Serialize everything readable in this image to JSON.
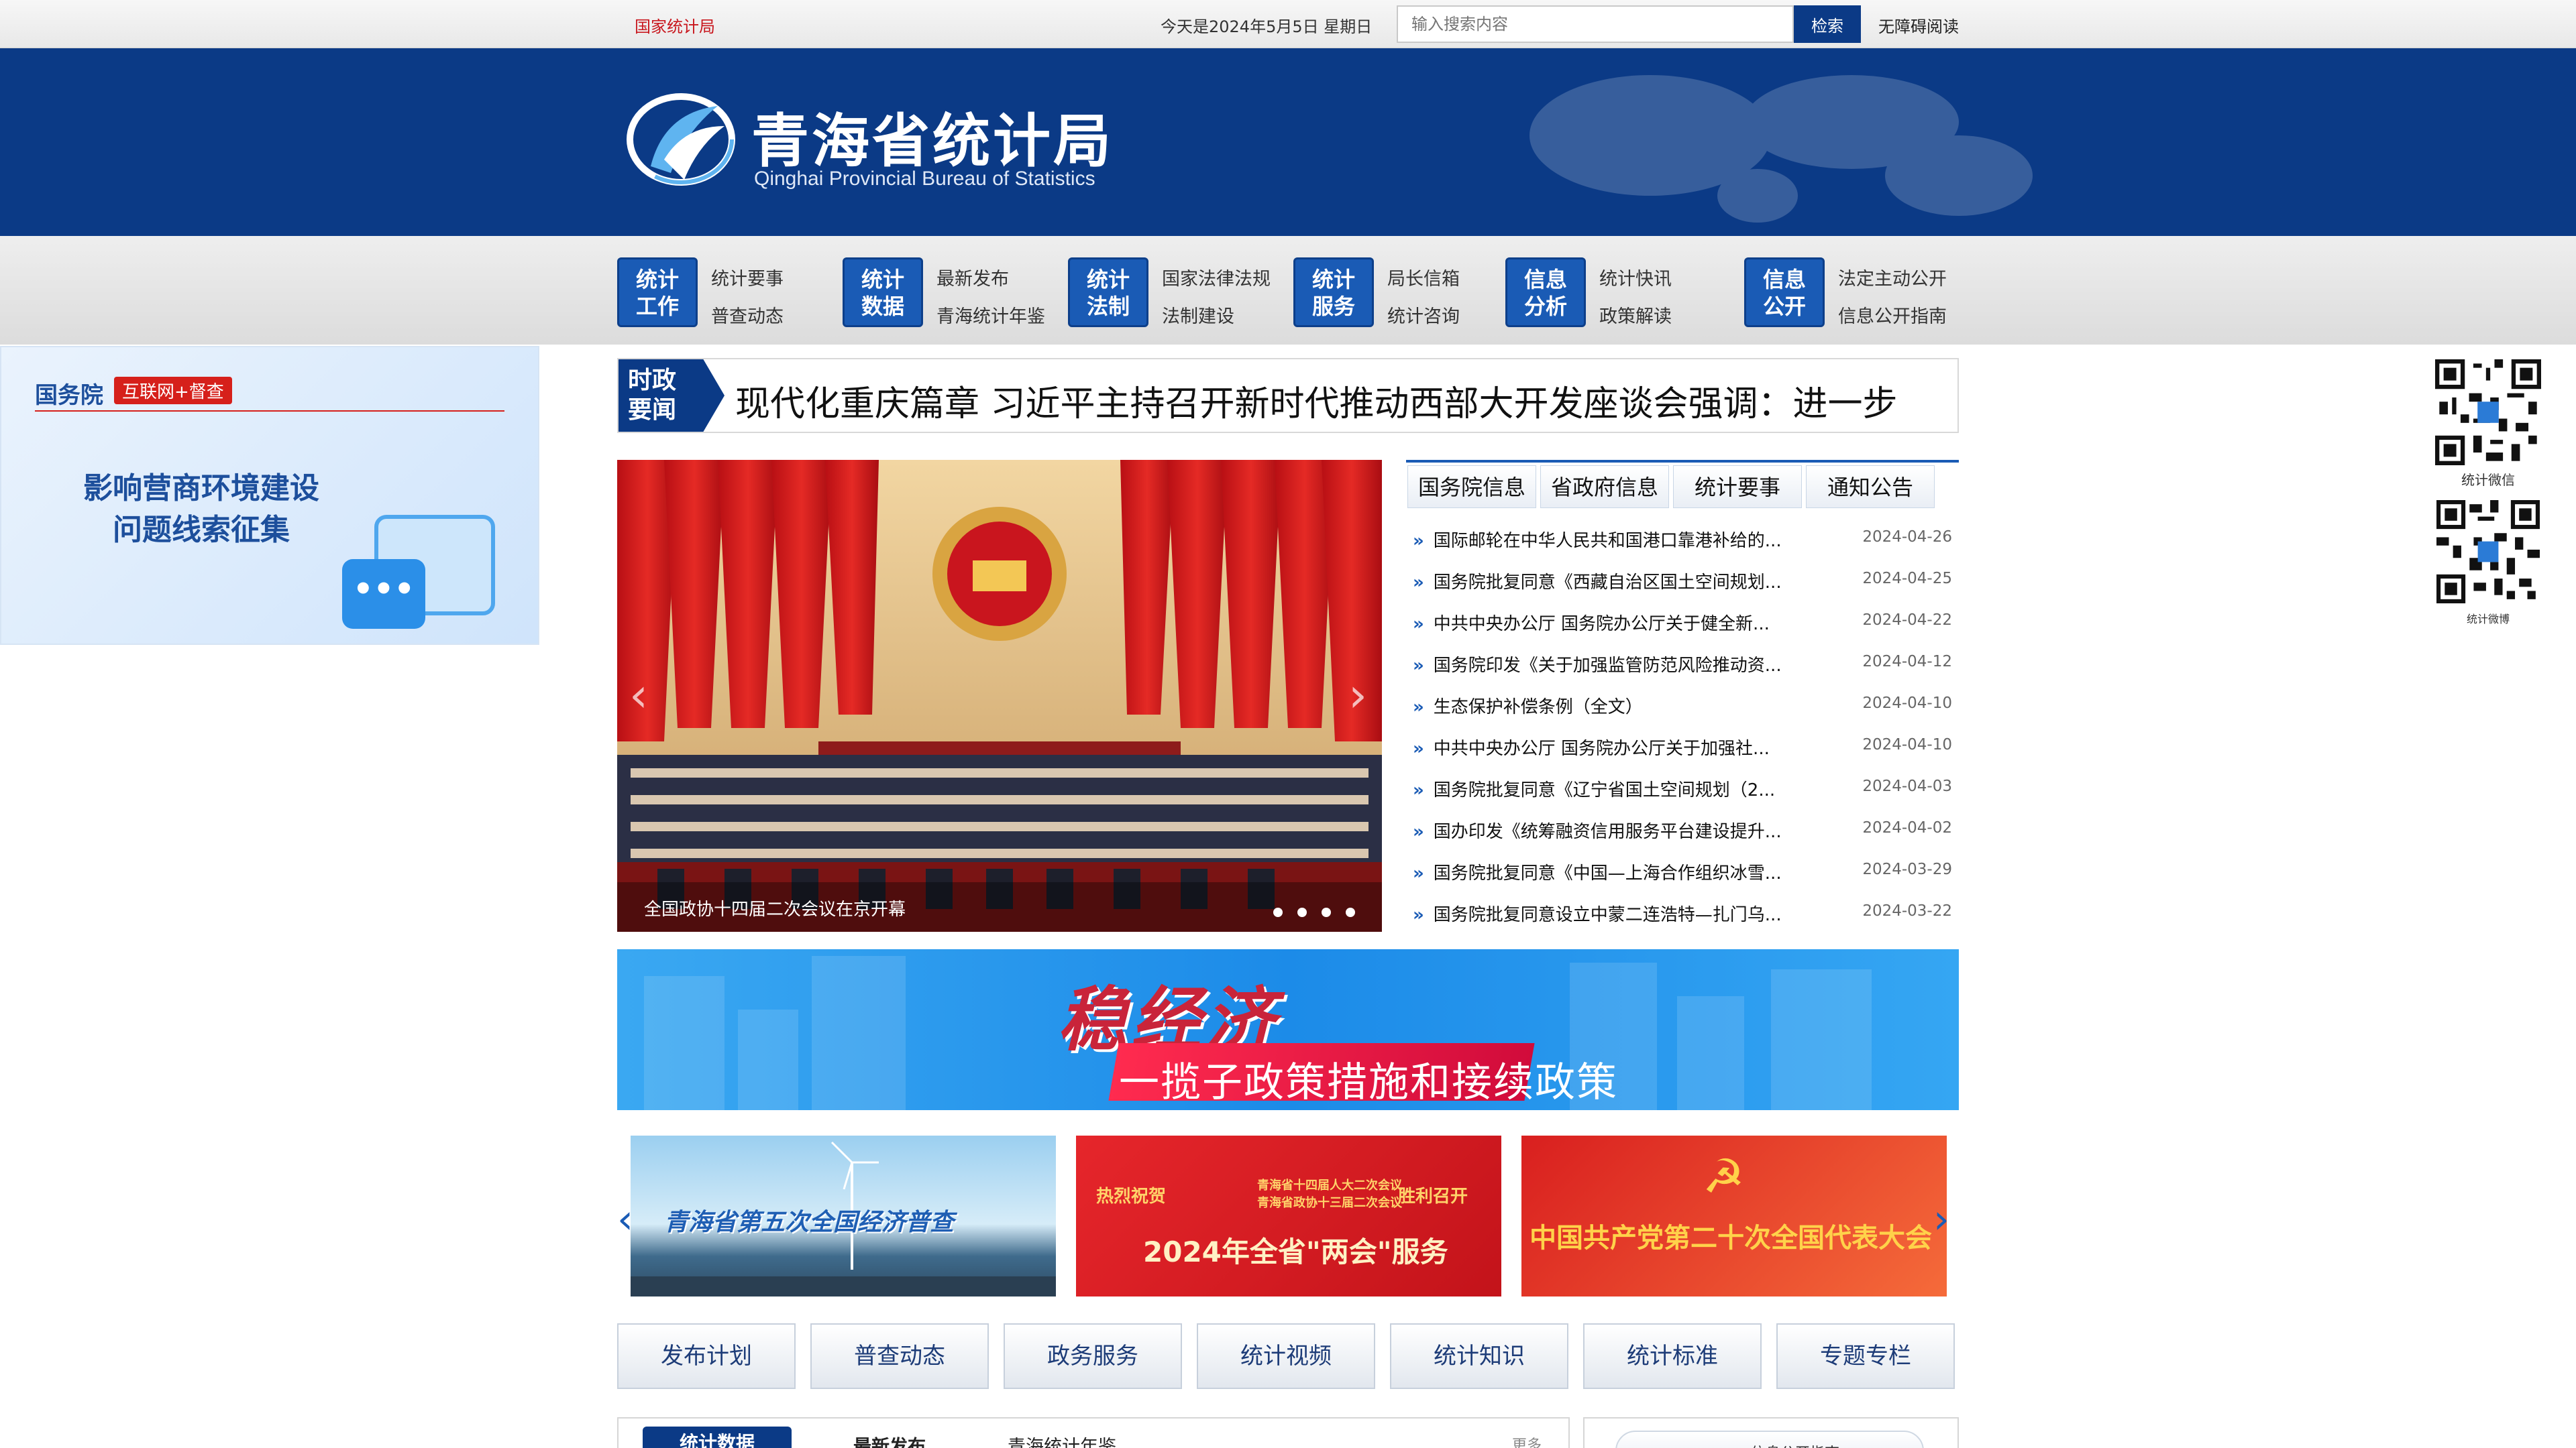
{
  "topbar": {
    "site_name": "国家统计局",
    "date": "今天是2024年5月5日   星期日",
    "search_placeholder": "输入搜索内容",
    "search_button": "检索",
    "accessibility": "无障碍阅读"
  },
  "header": {
    "title_cn": "青海省统计局",
    "title_en": "Qinghai Provincial Bureau of Statistics"
  },
  "nav": [
    {
      "badge_1": "统计",
      "badge_2": "工作",
      "link_1": "统计要事",
      "link_2": "普查动态"
    },
    {
      "badge_1": "统计",
      "badge_2": "数据",
      "link_1": "最新发布",
      "link_2": "青海统计年鉴"
    },
    {
      "badge_1": "统计",
      "badge_2": "法制",
      "link_1": "国家法律法规",
      "link_2": "法制建设"
    },
    {
      "badge_1": "统计",
      "badge_2": "服务",
      "link_1": "局长信箱",
      "link_2": "统计咨询"
    },
    {
      "badge_1": "信息",
      "badge_2": "分析",
      "link_1": "统计快讯",
      "link_2": "政策解读"
    },
    {
      "badge_1": "信息",
      "badge_2": "公开",
      "link_1": "法定主动公开",
      "link_2": "信息公开指南"
    }
  ],
  "left_banner": {
    "org": "国务院",
    "tag": "互联网+督查",
    "line1": "影响营商环境建设",
    "line2": "问题线索征集",
    "chat_glyph": "•••"
  },
  "qr": {
    "wechat_label": "统计微信",
    "weibo_label": "统计微博"
  },
  "headline": {
    "badge_1": "时政",
    "badge_2": "要闻",
    "text": "现代化重庆篇章     习近平主持召开新时代推动西部大开发座谈会强调：进一步"
  },
  "carousel": {
    "caption": "全国政协十四届二次会议在京开幕",
    "prev": "‹",
    "next": "›"
  },
  "news_tabs": [
    "国务院信息",
    "省政府信息",
    "统计要事",
    "通知公告"
  ],
  "news": [
    {
      "title": "国际邮轮在中华人民共和国港口靠港补给的...",
      "date": "2024-04-26"
    },
    {
      "title": "国务院批复同意《西藏自治区国土空间规划...",
      "date": "2024-04-25"
    },
    {
      "title": "中共中央办公厅 国务院办公厅关于健全新...",
      "date": "2024-04-22"
    },
    {
      "title": "国务院印发《关于加强监管防范风险推动资...",
      "date": "2024-04-12"
    },
    {
      "title": "生态保护补偿条例（全文）",
      "date": "2024-04-10"
    },
    {
      "title": "中共中央办公厅  国务院办公厅关于加强社...",
      "date": "2024-04-10"
    },
    {
      "title": "国务院批复同意《辽宁省国土空间规划（2...",
      "date": "2024-04-03"
    },
    {
      "title": "国办印发《统筹融资信用服务平台建设提升...",
      "date": "2024-04-02"
    },
    {
      "title": "国务院批复同意《中国—上海合作组织冰雪...",
      "date": "2024-03-29"
    },
    {
      "title": "国务院批复同意设立中蒙二连浩特—扎门乌...",
      "date": "2024-03-22"
    }
  ],
  "econ_banner": {
    "title": "稳经济",
    "subtitle": "一揽子政策措施和接续政策"
  },
  "promos": [
    {
      "text": "青海省第五次全国经济普查"
    },
    {
      "text": "2024年全省\"两会\"服务",
      "top_line": "热烈祝贺",
      "mid_line": "青海省十四届人大二次会议",
      "mid_line2": "青海省政协十三届二次会议",
      "suffix": "胜利召开"
    },
    {
      "text": "中国共产党第二十次全国代表大会"
    }
  ],
  "promo_arrows": {
    "left": "‹",
    "right": "›"
  },
  "quick_links": [
    "发布计划",
    "普查动态",
    "政务服务",
    "统计视频",
    "统计知识",
    "统计标准",
    "专题专栏"
  ],
  "bottom_panel": {
    "active_tab": "统计数据",
    "tab_2": "最新发布",
    "tab_3": "青海统计年鉴",
    "more": "更多",
    "right_pill": "信息公开指南"
  },
  "colors": {
    "brand_blue": "#0b3a86",
    "accent_red": "#c8161d",
    "link_blue": "#1a5bb5"
  }
}
